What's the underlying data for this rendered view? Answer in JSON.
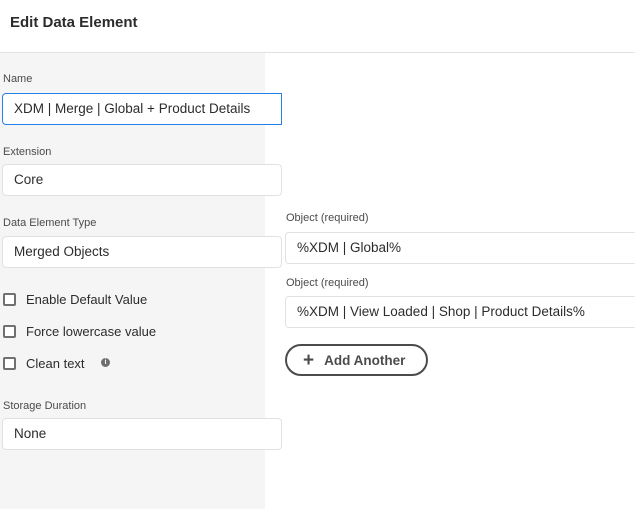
{
  "header": {
    "title": "Edit Data Element"
  },
  "left": {
    "name": {
      "label": "Name",
      "value": "XDM | Merge | Global + Product Details"
    },
    "extension": {
      "label": "Extension",
      "value": "Core"
    },
    "type": {
      "label": "Data Element Type",
      "value": "Merged Objects"
    },
    "checkboxes": [
      {
        "label": "Enable Default Value",
        "checked": false
      },
      {
        "label": "Force lowercase value",
        "checked": false
      },
      {
        "label": "Clean text",
        "checked": false,
        "icon": "info-icon"
      }
    ],
    "storage": {
      "label": "Storage Duration",
      "value": "None"
    }
  },
  "right": {
    "objects": [
      {
        "label": "Object (required)",
        "value": "%XDM | Global%"
      },
      {
        "label": "Object (required)",
        "value": "%XDM | View Loaded | Shop | Product Details%"
      }
    ],
    "add_button": {
      "icon": "plus-icon",
      "label": "Add Another"
    }
  }
}
